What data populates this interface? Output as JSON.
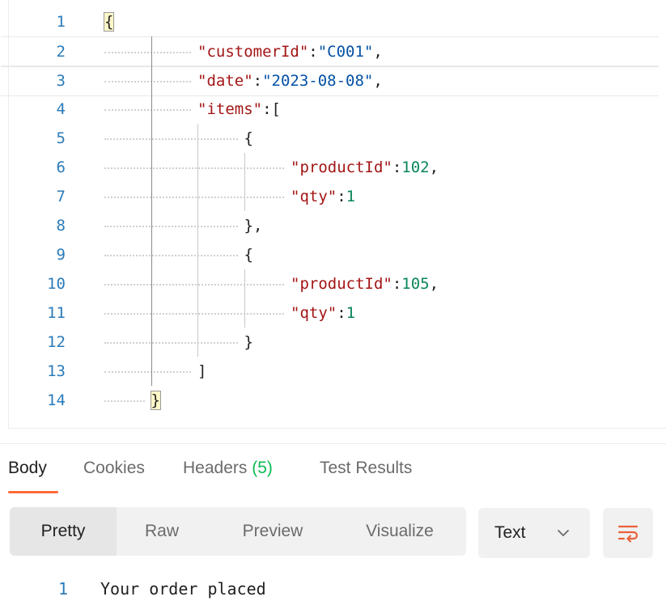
{
  "editor": {
    "lines": [
      {
        "num": "1",
        "parts": [
          {
            "c": "p",
            "t": "{",
            "hl": true
          }
        ]
      },
      {
        "num": "2",
        "parts": [
          {
            "c": "k",
            "t": "\"customerId\""
          },
          {
            "c": "p",
            "t": ":"
          },
          {
            "c": "s",
            "t": "\"C001\""
          },
          {
            "c": "p",
            "t": ","
          }
        ]
      },
      {
        "num": "3",
        "parts": [
          {
            "c": "k",
            "t": "\"date\""
          },
          {
            "c": "p",
            "t": ":"
          },
          {
            "c": "s",
            "t": "\"2023-08-08\""
          },
          {
            "c": "p",
            "t": ","
          }
        ]
      },
      {
        "num": "4",
        "parts": [
          {
            "c": "k",
            "t": "\"items\""
          },
          {
            "c": "p",
            "t": ":["
          }
        ]
      },
      {
        "num": "5",
        "parts": [
          {
            "c": "p",
            "t": "{"
          }
        ]
      },
      {
        "num": "6",
        "parts": [
          {
            "c": "k",
            "t": "\"productId\""
          },
          {
            "c": "p",
            "t": ":"
          },
          {
            "c": "n",
            "t": "102"
          },
          {
            "c": "p",
            "t": ","
          }
        ]
      },
      {
        "num": "7",
        "parts": [
          {
            "c": "k",
            "t": "\"qty\""
          },
          {
            "c": "p",
            "t": ":"
          },
          {
            "c": "n",
            "t": "1"
          }
        ]
      },
      {
        "num": "8",
        "parts": [
          {
            "c": "p",
            "t": "},"
          }
        ]
      },
      {
        "num": "9",
        "parts": [
          {
            "c": "p",
            "t": "{"
          }
        ]
      },
      {
        "num": "10",
        "parts": [
          {
            "c": "k",
            "t": "\"productId\""
          },
          {
            "c": "p",
            "t": ":"
          },
          {
            "c": "n",
            "t": "105"
          },
          {
            "c": "p",
            "t": ","
          }
        ]
      },
      {
        "num": "11",
        "parts": [
          {
            "c": "k",
            "t": "\"qty\""
          },
          {
            "c": "p",
            "t": ":"
          },
          {
            "c": "n",
            "t": "1"
          }
        ]
      },
      {
        "num": "12",
        "parts": [
          {
            "c": "p",
            "t": "}"
          }
        ]
      },
      {
        "num": "13",
        "parts": [
          {
            "c": "p",
            "t": "]"
          }
        ]
      },
      {
        "num": "14",
        "parts": [
          {
            "c": "p",
            "t": "}",
            "hl": true
          }
        ]
      }
    ],
    "indent_levels": [
      0,
      2,
      2,
      2,
      3,
      4,
      4,
      3,
      3,
      4,
      4,
      3,
      2,
      1
    ]
  },
  "response_tabs": {
    "body": "Body",
    "cookies": "Cookies",
    "headers": "Headers",
    "headers_count": "(5)",
    "test_results": "Test Results"
  },
  "view_modes": {
    "pretty": "Pretty",
    "raw": "Raw",
    "preview": "Preview",
    "visualize": "Visualize"
  },
  "format_select": {
    "value": "Text"
  },
  "wrap_icon": "wrap-lines-icon",
  "response": {
    "line_num": "1",
    "text": "Your order placed"
  },
  "colors": {
    "accent": "#ff6c37",
    "line_number": "#2b7bb9",
    "key": "#a31515",
    "string": "#0451a5",
    "number": "#098658",
    "count": "#0cbb52"
  }
}
